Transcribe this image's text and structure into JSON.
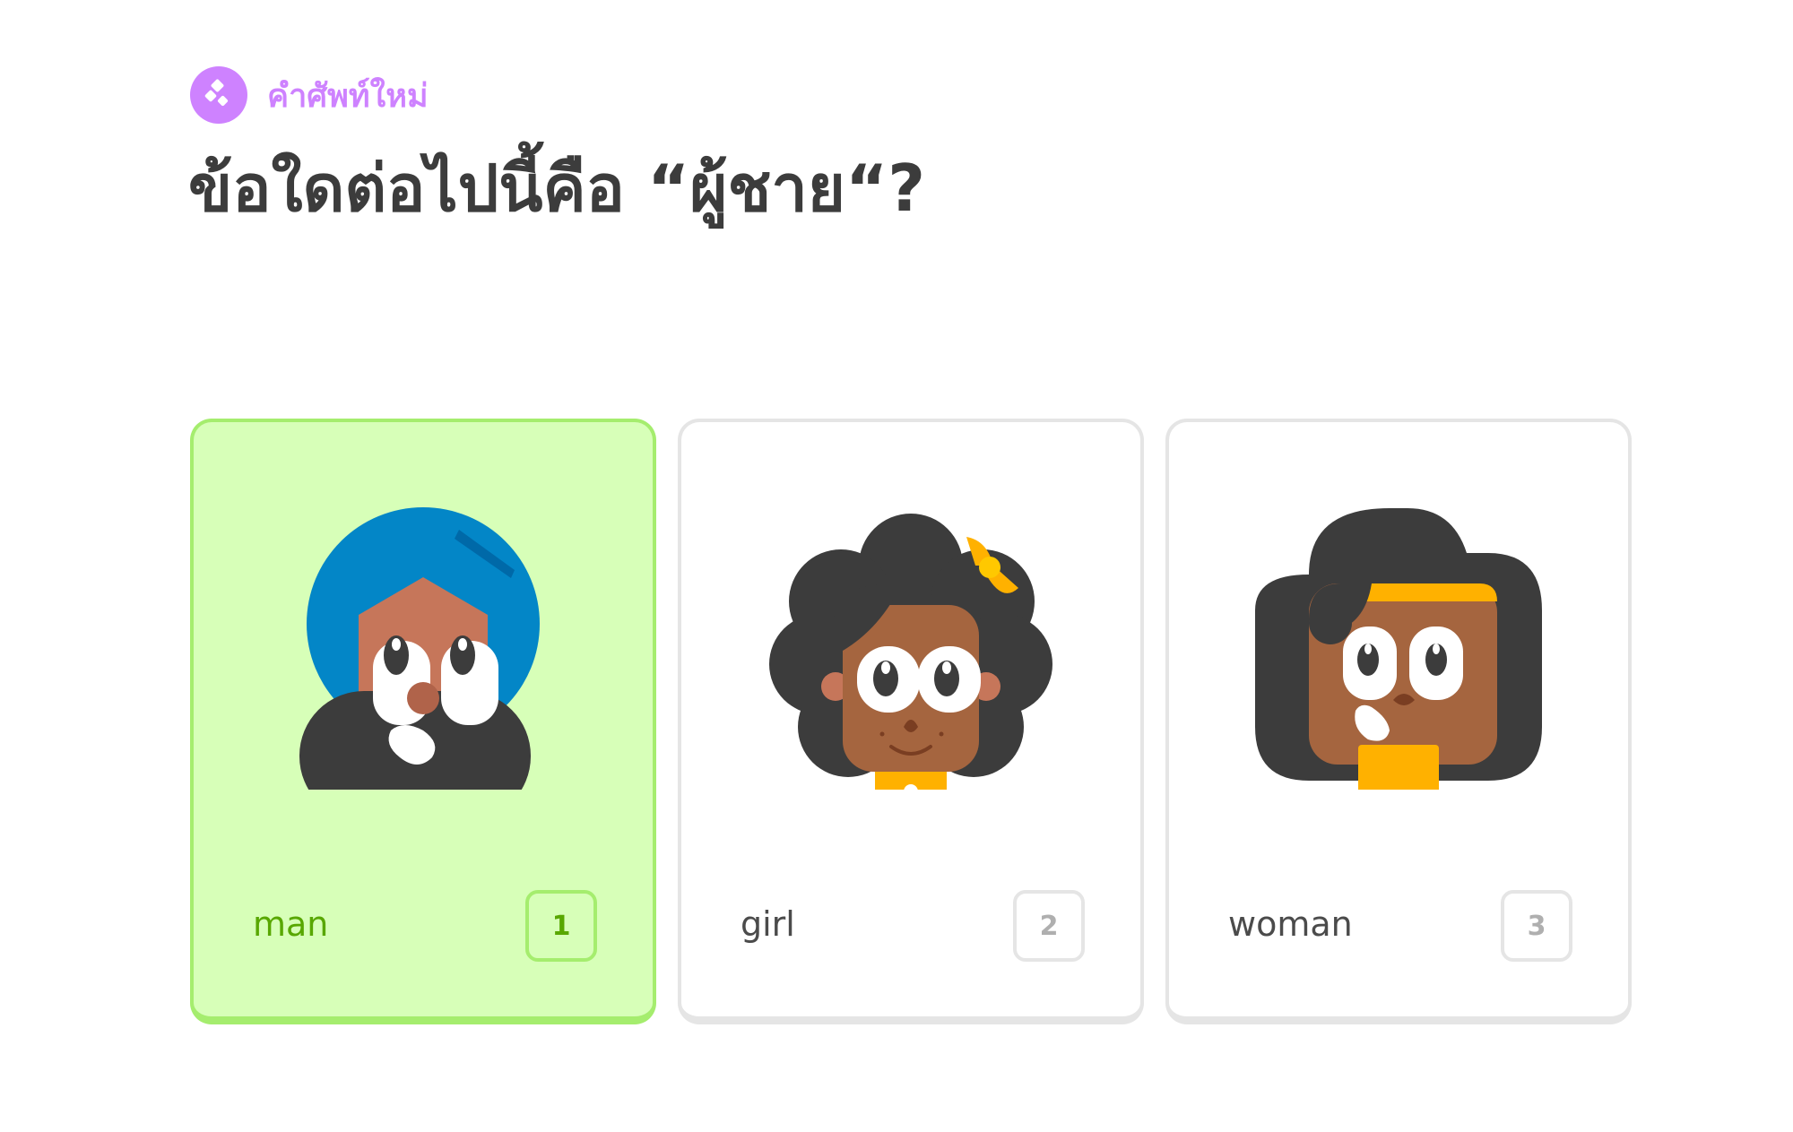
{
  "header": {
    "badge_icon": "new-word-sparkle-icon",
    "badge_label": "คำศัพท์ใหม่",
    "question": "ข้อใดต่อไปนี้คือ “ผู้ชาย“?"
  },
  "colors": {
    "badge": "#ce82ff",
    "selected_bg": "#d7ffb8",
    "selected_border": "#a5ed6e",
    "selected_text": "#58a700",
    "card_border": "#e5e5e5",
    "text": "#4b4b4b",
    "title": "#3c3c3c"
  },
  "options": [
    {
      "word": "man",
      "key": "1",
      "selected": true,
      "illustration": "man-turban-illustration"
    },
    {
      "word": "girl",
      "key": "2",
      "selected": false,
      "illustration": "girl-curly-hair-illustration"
    },
    {
      "word": "woman",
      "key": "3",
      "selected": false,
      "illustration": "woman-headband-illustration"
    }
  ]
}
